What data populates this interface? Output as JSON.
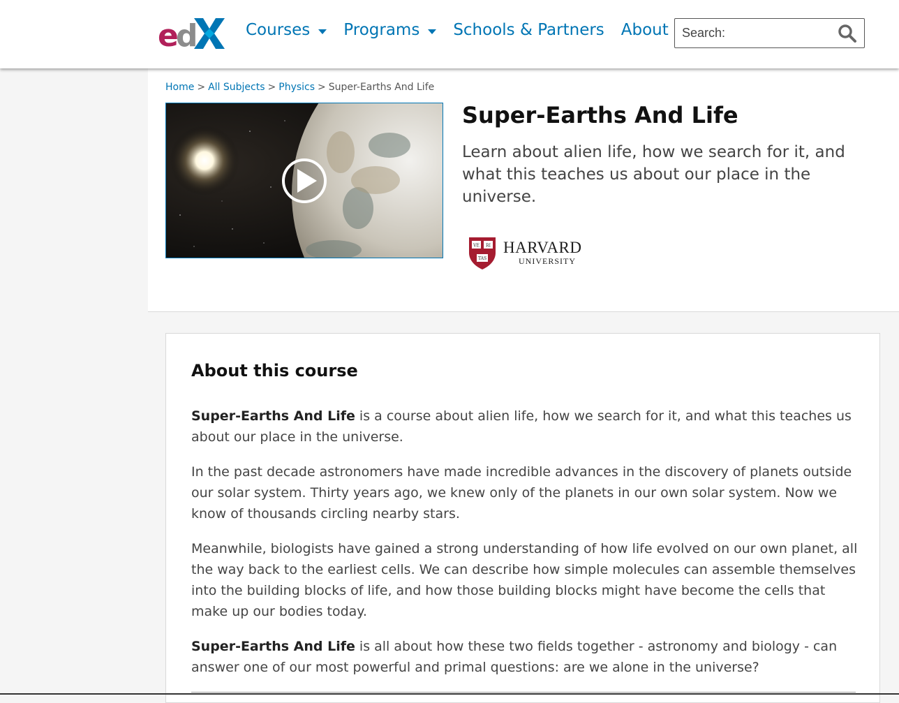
{
  "header": {
    "logo": {
      "letters": "edX",
      "colors": {
        "e": "#b1205a",
        "d": "#8c8c8c",
        "x": "#0075b4"
      }
    },
    "nav": [
      {
        "label": "Courses",
        "dropdown": true
      },
      {
        "label": "Programs",
        "dropdown": true
      },
      {
        "label": "Schools & Partners",
        "dropdown": false
      },
      {
        "label": "About",
        "dropdown": true
      }
    ],
    "search": {
      "placeholder": "Search:",
      "icon": "search-icon"
    }
  },
  "breadcrumb": {
    "home": "Home",
    "sep": ">",
    "subjects": "All Subjects",
    "physics": "Physics",
    "current": "Super-Earths And Life"
  },
  "course": {
    "title": "Super-Earths And Life",
    "subtitle": "Learn about alien life, how we search for it, and what this teaches us about our place in the universe.",
    "video": {
      "icon": "play-icon"
    },
    "school": {
      "name": "HARVARD",
      "sub": "UNIVERSITY",
      "shield_text": [
        "VE",
        "RI",
        "TAS"
      ],
      "color": "#a51c30"
    }
  },
  "about": {
    "heading": "About this course",
    "p1_bold": "Super-Earths And Life",
    "p1_rest": " is a course about alien life, how we search for it, and what this teaches us about our place in the universe.",
    "p2": "In the past decade astronomers have made incredible advances in the discovery of planets outside our solar system. Thirty years ago, we knew only of the planets in our own solar system. Now we know of thousands circling nearby stars.",
    "p3": "Meanwhile, biologists have gained a strong understanding of how life evolved on our own planet, all the way back to the earliest cells. We can describe how simple molecules can assemble themselves into the building blocks of life, and how those building blocks might have become the cells that make up our bodies today.",
    "p4_bold": "Super-Earths And Life",
    "p4_rest": " is all about how these two fields together - astronomy and biology - can answer one of our most powerful and primal questions: are we alone in the universe?"
  }
}
